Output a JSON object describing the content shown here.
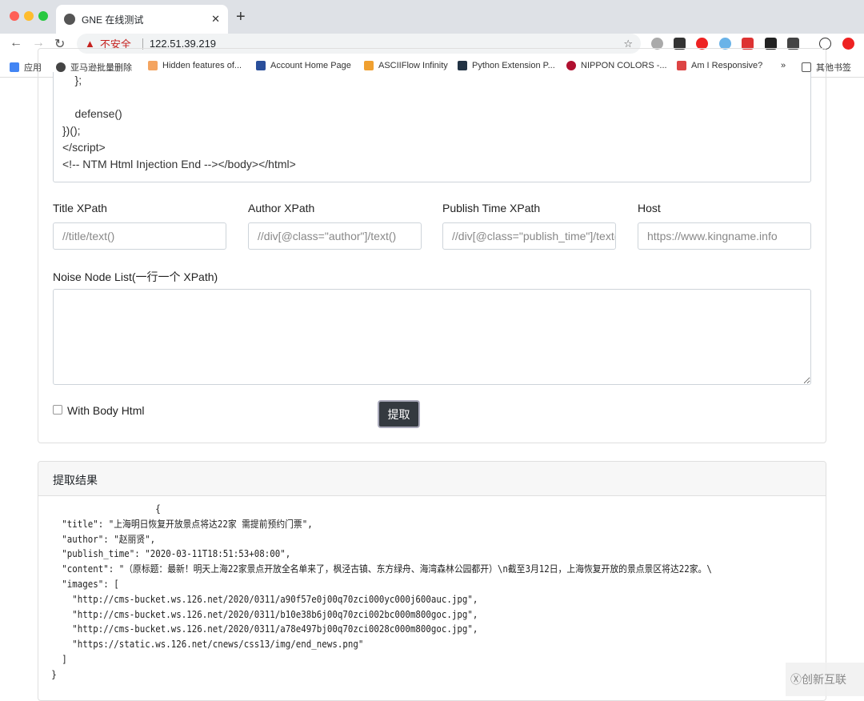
{
  "browser": {
    "tab_title": "GNE 在线测试",
    "security": "不安全",
    "url": "122.51.39.219",
    "bookmarks": [
      "应用",
      "亚马逊批量删除",
      "Hidden features of...",
      "Account Home Page",
      "ASCIIFlow Infinity",
      "Python Extension P...",
      "NIPPON COLORS -...",
      "Am I Responsive?",
      "»",
      "其他书签"
    ]
  },
  "form": {
    "html_tail": "    };\n\n    defense()\n})();\n</script>\n<!-- NTM Html Injection End --></body></html>",
    "title_label": "Title XPath",
    "title_placeholder": "//title/text()",
    "author_label": "Author XPath",
    "author_placeholder": "//div[@class=\"author\"]/text()",
    "publish_label": "Publish Time XPath",
    "publish_placeholder": "//div[@class=\"publish_time\"]/text()",
    "host_label": "Host",
    "host_placeholder": "https://www.kingname.info",
    "noise_label": "Noise Node List(一行一个 XPath)",
    "with_body_label": "With Body Html",
    "submit": "提取"
  },
  "result": {
    "header": "提取结果",
    "json": "                    {\n  \"title\": \"上海明日恢复开放景点将达22家 需提前预约门票\",\n  \"author\": \"赵丽贤\",\n  \"publish_time\": \"2020-03-11T18:51:53+08:00\",\n  \"content\": \"（原标题：最新！明天上海22家景点开放全名单来了，枫泾古镇、东方绿舟、海湾森林公园都开）\\n截至3月12日，上海恢复开放的景点景区将达22家。\\\n  \"images\": [\n    \"http://cms-bucket.ws.126.net/2020/0311/a90f57e0j00q70zci000yc000j600auc.jpg\",\n    \"http://cms-bucket.ws.126.net/2020/0311/b10e38b6j00q70zci002bc000m800goc.jpg\",\n    \"http://cms-bucket.ws.126.net/2020/0311/a78e497bj00q70zci0028c000m800goc.jpg\",\n    \"https://static.ws.126.net/cnews/css13/img/end_news.png\"\n  ]\n}"
  },
  "watermark": "创新互联"
}
